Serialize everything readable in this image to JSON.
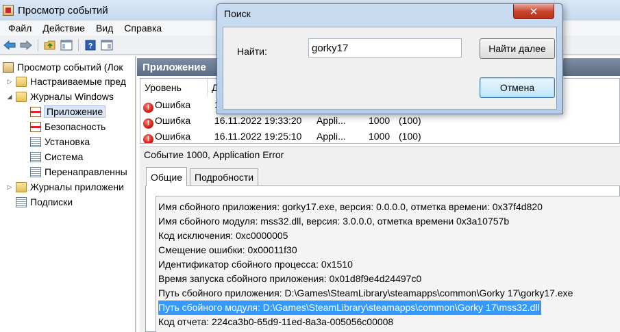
{
  "window": {
    "title": "Просмотр событий"
  },
  "menu": [
    "Файл",
    "Действие",
    "Вид",
    "Справка"
  ],
  "tree": {
    "root": "Просмотр событий (Лок",
    "custom_views": "Настраиваемые пред",
    "windows_logs": "Журналы Windows",
    "logs": [
      "Приложение",
      "Безопасность",
      "Установка",
      "Система",
      "Перенаправленны"
    ],
    "app_logs": "Журналы приложени",
    "subscriptions": "Подписки"
  },
  "pane": {
    "title": "Приложение"
  },
  "list": {
    "col_level": "Уровень",
    "col_date_partial": "Д",
    "rows": [
      {
        "level": "Ошибка",
        "date": "1",
        "source": "",
        "id": "",
        "category": ""
      },
      {
        "level": "Ошибка",
        "date": "16.11.2022 19:33:20",
        "source": "Appli...",
        "id": "1000",
        "category": "(100)"
      },
      {
        "level": "Ошибка",
        "date": "16.11.2022 19:25:10",
        "source": "Appli...",
        "id": "1000",
        "category": "(100)"
      }
    ]
  },
  "detail": {
    "header": "Событие 1000, Application Error",
    "tab_general": "Общие",
    "tab_details": "Подробности",
    "lines": [
      "Имя сбойного приложения: gorky17.exe, версия: 0.0.0.0, отметка времени: 0x37f4d820",
      "Имя сбойного модуля: mss32.dll, версия: 3.0.0.0, отметка времени 0x3a10757b",
      "Код исключения: 0xc0000005",
      "Смещение ошибки: 0x00011f30",
      "Идентификатор сбойного процесса: 0x1510",
      "Время запуска сбойного приложения: 0x01d8f9e4d24497c0",
      "Путь сбойного приложения: D:\\Games\\SteamLibrary\\steamapps\\common\\Gorky 17\\gorky17.exe",
      "Путь сбойного модуля: D:\\Games\\SteamLibrary\\steamapps\\common\\Gorky 17\\mss32.dll",
      "Код отчета: 224ca3b0-65d9-11ed-8a3a-005056c00008"
    ],
    "highlighted_line": 7
  },
  "search_dialog": {
    "title": "Поиск",
    "find_label": "Найти:",
    "find_value": "gorky17",
    "find_next": "Найти далее",
    "cancel": "Отмена"
  }
}
